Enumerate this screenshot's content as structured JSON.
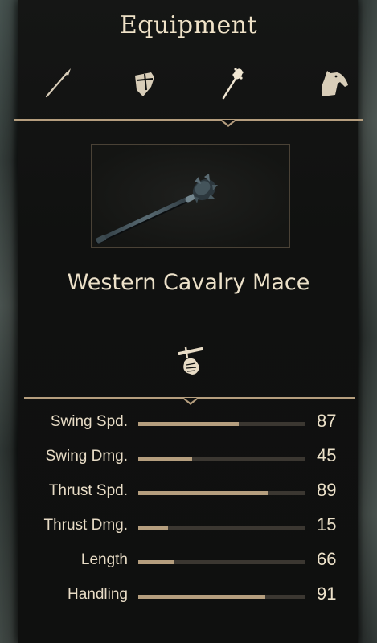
{
  "header": {
    "title": "Equipment"
  },
  "tabs": [
    {
      "icon": "spear-icon",
      "active": false
    },
    {
      "icon": "shield-icon",
      "active": false
    },
    {
      "icon": "mace-icon",
      "active": true
    },
    {
      "icon": "horse-icon",
      "active": false
    }
  ],
  "item": {
    "name": "Western Cavalry Mace",
    "image_icon": "mace-image",
    "type_icon": "one-handed-weapon-icon"
  },
  "stats": [
    {
      "label": "Swing Spd.",
      "value": "87",
      "fill": 0.6
    },
    {
      "label": "Swing Dmg.",
      "value": "45",
      "fill": 0.32
    },
    {
      "label": "Thrust Spd.",
      "value": "89",
      "fill": 0.78
    },
    {
      "label": "Thrust Dmg.",
      "value": "15",
      "fill": 0.18
    },
    {
      "label": "Length",
      "value": "66",
      "fill": 0.21
    },
    {
      "label": "Handling",
      "value": "91",
      "fill": 0.76
    }
  ],
  "colors": {
    "accent": "#b59e7e",
    "text": "#ece1c9",
    "panel": "#101110",
    "track": "#3b3731"
  }
}
